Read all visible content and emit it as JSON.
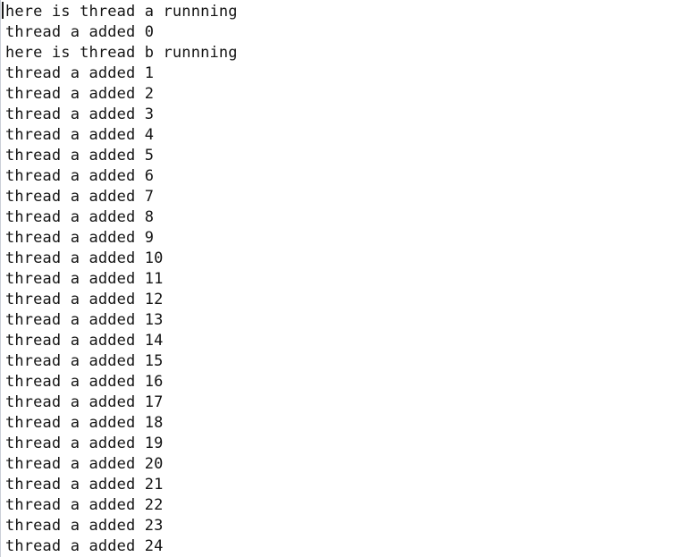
{
  "window": {
    "kind": "console-output-pane",
    "background_color": "#ffffff",
    "text_color": "#141414",
    "left_rule_color": "#b9bfcb",
    "caret_color": "#1b1b1b"
  },
  "caret": {
    "present": true,
    "line_index": 0,
    "column": 0
  },
  "console": {
    "line_count": 28,
    "lines": [
      {
        "text": "here is thread a runnning"
      },
      {
        "text": "thread a added 0"
      },
      {
        "text": "here is thread b runnning"
      },
      {
        "text": "thread a added 1"
      },
      {
        "text": "thread a added 2"
      },
      {
        "text": "thread a added 3"
      },
      {
        "text": "thread a added 4"
      },
      {
        "text": "thread a added 5"
      },
      {
        "text": "thread a added 6"
      },
      {
        "text": "thread a added 7"
      },
      {
        "text": "thread a added 8"
      },
      {
        "text": "thread a added 9"
      },
      {
        "text": "thread a added 10"
      },
      {
        "text": "thread a added 11"
      },
      {
        "text": "thread a added 12"
      },
      {
        "text": "thread a added 13"
      },
      {
        "text": "thread a added 14"
      },
      {
        "text": "thread a added 15"
      },
      {
        "text": "thread a added 16"
      },
      {
        "text": "thread a added 17"
      },
      {
        "text": "thread a added 18"
      },
      {
        "text": "thread a added 19"
      },
      {
        "text": "thread a added 20"
      },
      {
        "text": "thread a added 21"
      },
      {
        "text": "thread a added 22"
      },
      {
        "text": "thread a added 23"
      },
      {
        "text": "thread a added 24"
      }
    ]
  }
}
